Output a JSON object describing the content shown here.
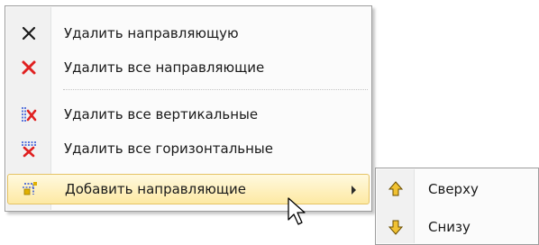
{
  "menu": {
    "items": [
      {
        "label": "Удалить направляющую",
        "icon": "close-x-icon"
      },
      {
        "label": "Удалить все направляющие",
        "icon": "red-x-icon"
      },
      {
        "label": "Удалить все вертикальные",
        "icon": "delete-vertical-guides-icon"
      },
      {
        "label": "Удалить все горизонтальные",
        "icon": "delete-horizontal-guides-icon"
      },
      {
        "label": "Добавить направляющие",
        "icon": "add-guides-icon",
        "highlighted": true
      }
    ]
  },
  "submenu": {
    "items": [
      {
        "label": "Сверху",
        "icon": "arrow-up-icon"
      },
      {
        "label": "Снизу",
        "icon": "arrow-down-icon"
      }
    ]
  },
  "colors": {
    "highlight": "#fde9a3",
    "highlight_border": "#e5c365",
    "delete_red": "#e02020",
    "guide_blue": "#2a4fd6",
    "arrow_gold": "#e0b000"
  }
}
